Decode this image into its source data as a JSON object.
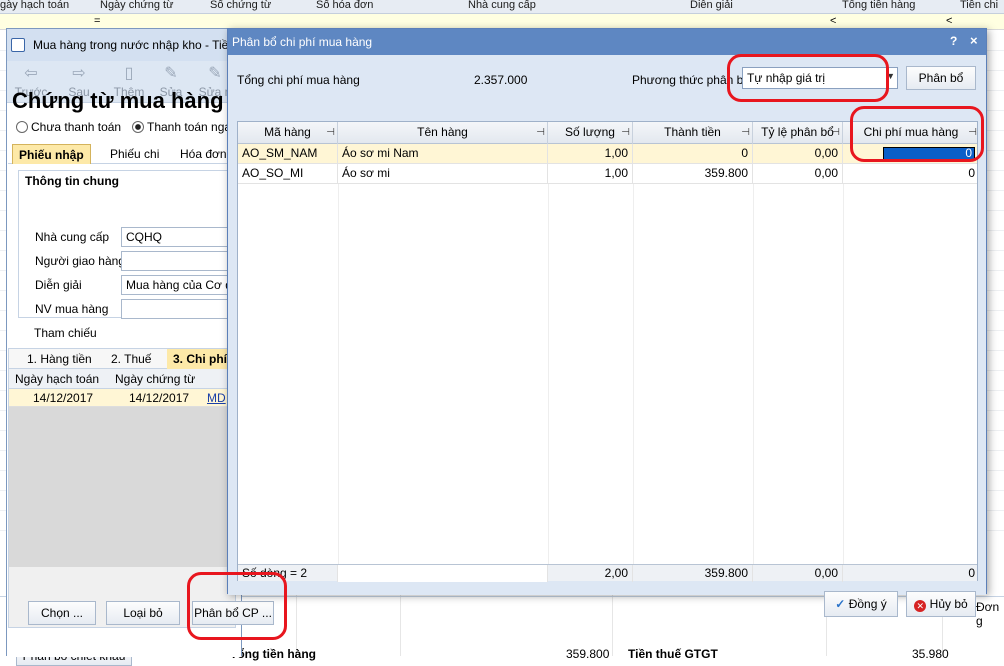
{
  "background_grid": {
    "headers": [
      "gày hạch toán",
      "Ngày chứng từ",
      "Số chứng từ",
      "Số hóa đơn",
      "Nhà cung cấp",
      "Diễn giải",
      "Tổng tiền hàng",
      "Tiền chi"
    ],
    "filter_eq": "=",
    "filter_lt": "<",
    "bottom_left_label": "Phân bổ chiết khấu",
    "summary_total_label": "Tổng tiền hàng",
    "summary_total_value": "359.800",
    "summary_vat_label": "Tiền thuế GTGT",
    "summary_vat_value": "35.980",
    "right_header": "Đơn g"
  },
  "window": {
    "title": "Mua hàng trong nước nhập kho - Tiền",
    "toolbar": [
      {
        "label": "Trước",
        "icon": "arrow-left-icon"
      },
      {
        "label": "Sau",
        "icon": "arrow-right-icon"
      },
      {
        "label": "Thêm",
        "icon": "add-document-icon"
      },
      {
        "label": "Sửa",
        "icon": "edit-icon"
      },
      {
        "label": "Sửa n",
        "icon": "edit-many-icon"
      }
    ],
    "doc_title": "Chứng từ mua hàng",
    "payment_options": [
      "Chưa thanh toán",
      "Thanh toán ngay"
    ],
    "payment_selected": "Thanh toán ngay",
    "tabs": [
      "Phiếu nhập",
      "Phiếu chi",
      "Hóa đơn"
    ],
    "active_tab": "Phiếu nhập",
    "group_title": "Thông tin chung",
    "fields": [
      {
        "label": "Nhà cung cấp",
        "value": "CQHQ"
      },
      {
        "label": "Người giao hàng",
        "value": ""
      },
      {
        "label": "Diễn giải",
        "value": "Mua hàng của Cơ qu"
      },
      {
        "label": "NV mua hàng",
        "value": ""
      },
      {
        "label": "Tham chiếu",
        "value": ""
      }
    ],
    "detail_tabs": [
      "1. Hàng tiền",
      "2. Thuế",
      "3. Chi phí"
    ],
    "detail_columns": [
      "Ngày hạch toán",
      "Ngày chứng từ"
    ],
    "detail_row": {
      "posting_date": "14/12/2017",
      "doc_date": "14/12/2017",
      "code": "MD"
    },
    "buttons": {
      "select": "Chọn ...",
      "remove": "Loại bỏ",
      "allocate": "Phân bổ CP ..."
    }
  },
  "dialog": {
    "title": "Phân bổ chi phí mua hàng",
    "help": "?",
    "close": "×",
    "total_label": "Tổng chi phí mua hàng",
    "total_value": "2.357.000",
    "method_label": "Phương thức phân bổ",
    "method_value": "Tự nhập giá trị",
    "allocate_button": "Phân bổ",
    "columns": [
      "Mã hàng",
      "Tên hàng",
      "Số lượng",
      "Thành tiền",
      "Tỷ lệ phân bổ",
      "Chi phí mua hàng"
    ],
    "rows": [
      {
        "code": "AO_SM_NAM",
        "name": "Áo sơ mi Nam",
        "qty": "1,00",
        "amount": "0",
        "ratio": "0,00",
        "cost": "0"
      },
      {
        "code": "AO_SO_MI",
        "name": "Áo sơ mi",
        "qty": "1,00",
        "amount": "359.800",
        "ratio": "0,00",
        "cost": "0"
      }
    ],
    "footer": {
      "count": "Số dòng = 2",
      "qty": "2,00",
      "amount": "359.800",
      "ratio": "0,00",
      "cost": "0"
    },
    "ok_button": "Đồng ý",
    "cancel_button": "Hủy bỏ"
  },
  "colors": {
    "highlight": "#e8161e",
    "title_bar": "#5e87c2",
    "selected_row": "#fff6d5",
    "selected_cell": "#0a5fc8"
  }
}
